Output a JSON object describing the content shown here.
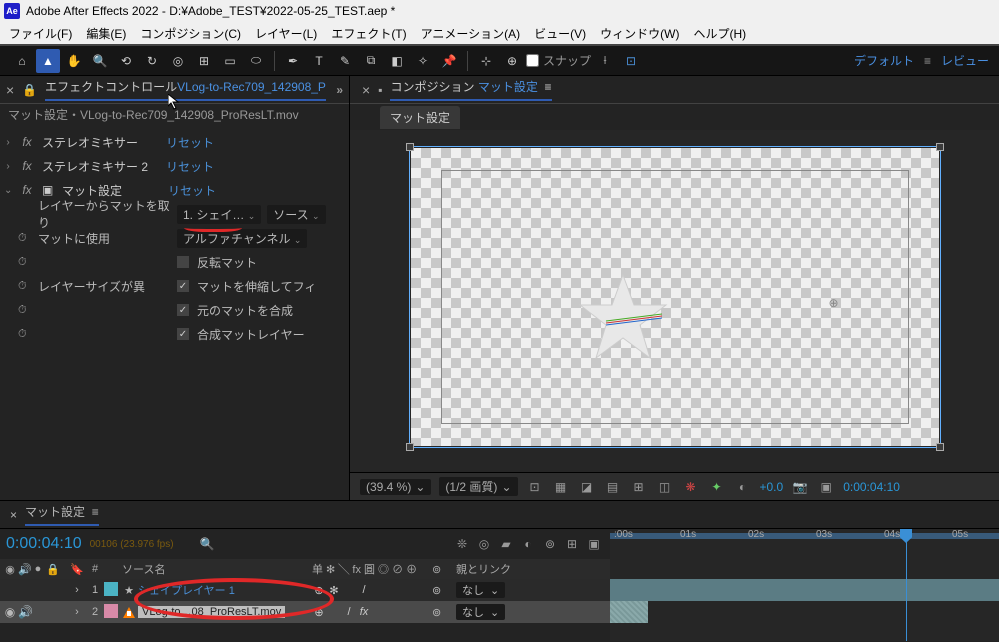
{
  "title": "Adobe After Effects 2022 - D:¥Adobe_TEST¥2022-05-25_TEST.aep *",
  "menu": [
    "ファイル(F)",
    "編集(E)",
    "コンポジション(C)",
    "レイヤー(L)",
    "エフェクト(T)",
    "アニメーション(A)",
    "ビュー(V)",
    "ウィンドウ(W)",
    "ヘルプ(H)"
  ],
  "toolbar": {
    "snap": "スナップ",
    "default": "デフォルト",
    "review": "レビュー"
  },
  "effects_panel": {
    "tab": "エフェクトコントロール",
    "tab_link": "VLog-to-Rec709_142908_P",
    "menu": "»",
    "header": "マット設定・VLog-to-Rec709_142908_ProResLT.mov",
    "reset": "リセット",
    "fx": [
      "ステレオミキサー",
      "ステレオミキサー 2",
      "マット設定"
    ],
    "props": {
      "layer_from": "レイヤーからマットを取り",
      "layer_val": "1. シェイ…",
      "source": "ソース",
      "use_for": "マットに使用",
      "use_val": "アルファチャンネル",
      "invert": "反転マット",
      "stretch": "マットを伸縮してフィ",
      "composite": "元のマットを合成",
      "layersize": "レイヤーサイズが異",
      "comp_layer": "合成マットレイヤー"
    }
  },
  "comp_panel": {
    "tab": "コンポジション",
    "tab_link": "マット設定",
    "subtab": "マット設定"
  },
  "viewer_footer": {
    "zoom": "(39.4 %)",
    "res": "(1/2 画質)",
    "exposure": "+0.0",
    "time": "0:00:04:10"
  },
  "timeline": {
    "tab": "マット設定",
    "timecode": "0:00:04:10",
    "fps": "00106 (23.976 fps)",
    "col_source": "ソース名",
    "col_switches": "单 ✻ ╲ fx 圓 ◎ ⊘ ⊕",
    "col_parent": "親とリンク",
    "none_label": "なし",
    "layers": [
      {
        "num": "1",
        "name": "シェイプレイヤー 1",
        "icon": "★",
        "parent": "なし"
      },
      {
        "num": "2",
        "name": "VLog-to…08_ProResLT.mov",
        "icon": "vlc",
        "parent": "なし"
      }
    ],
    "ticks": [
      ":00s",
      "01s",
      "02s",
      "03s",
      "04s",
      "05s"
    ]
  }
}
